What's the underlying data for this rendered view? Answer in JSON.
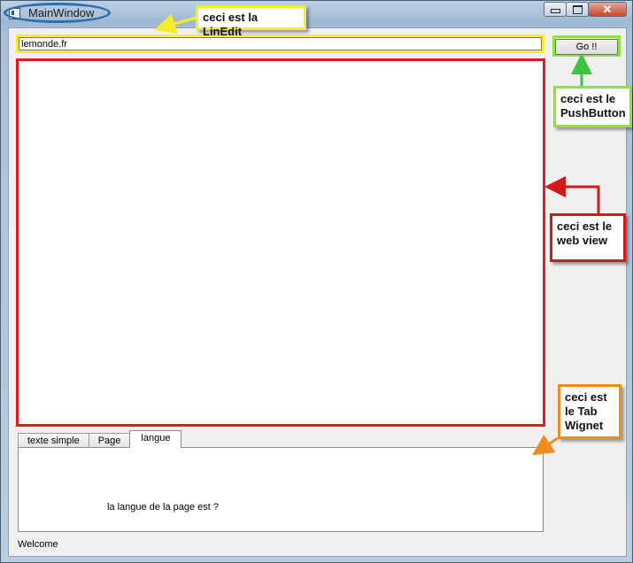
{
  "window": {
    "title": "MainWindow",
    "min_glyph": "minimize-icon",
    "max_glyph": "maximize-icon",
    "close_glyph": "✕"
  },
  "toolbar": {
    "url_value": "lemonde.fr",
    "go_label": "Go !!"
  },
  "tabs": [
    {
      "label": "texte simple",
      "active": false
    },
    {
      "label": "Page",
      "active": false
    },
    {
      "label": "langue",
      "active": true
    }
  ],
  "tab_content": {
    "text": "la langue de la page est ?"
  },
  "status": {
    "text": "Welcome"
  },
  "annotations": {
    "lineedit": "ceci est la LinEdit",
    "pushbutton": "ceci est le PushButton",
    "webview": "ceci est le web view",
    "tab": "ceci est le Tab Wignet"
  },
  "colors": {
    "lineedit_highlight": "#f2ee2a",
    "button_highlight": "#8ee33a",
    "webview_highlight": "#e01d1d",
    "tab_highlight": "#ef8c1f",
    "title_highlight": "#2d6db0"
  }
}
